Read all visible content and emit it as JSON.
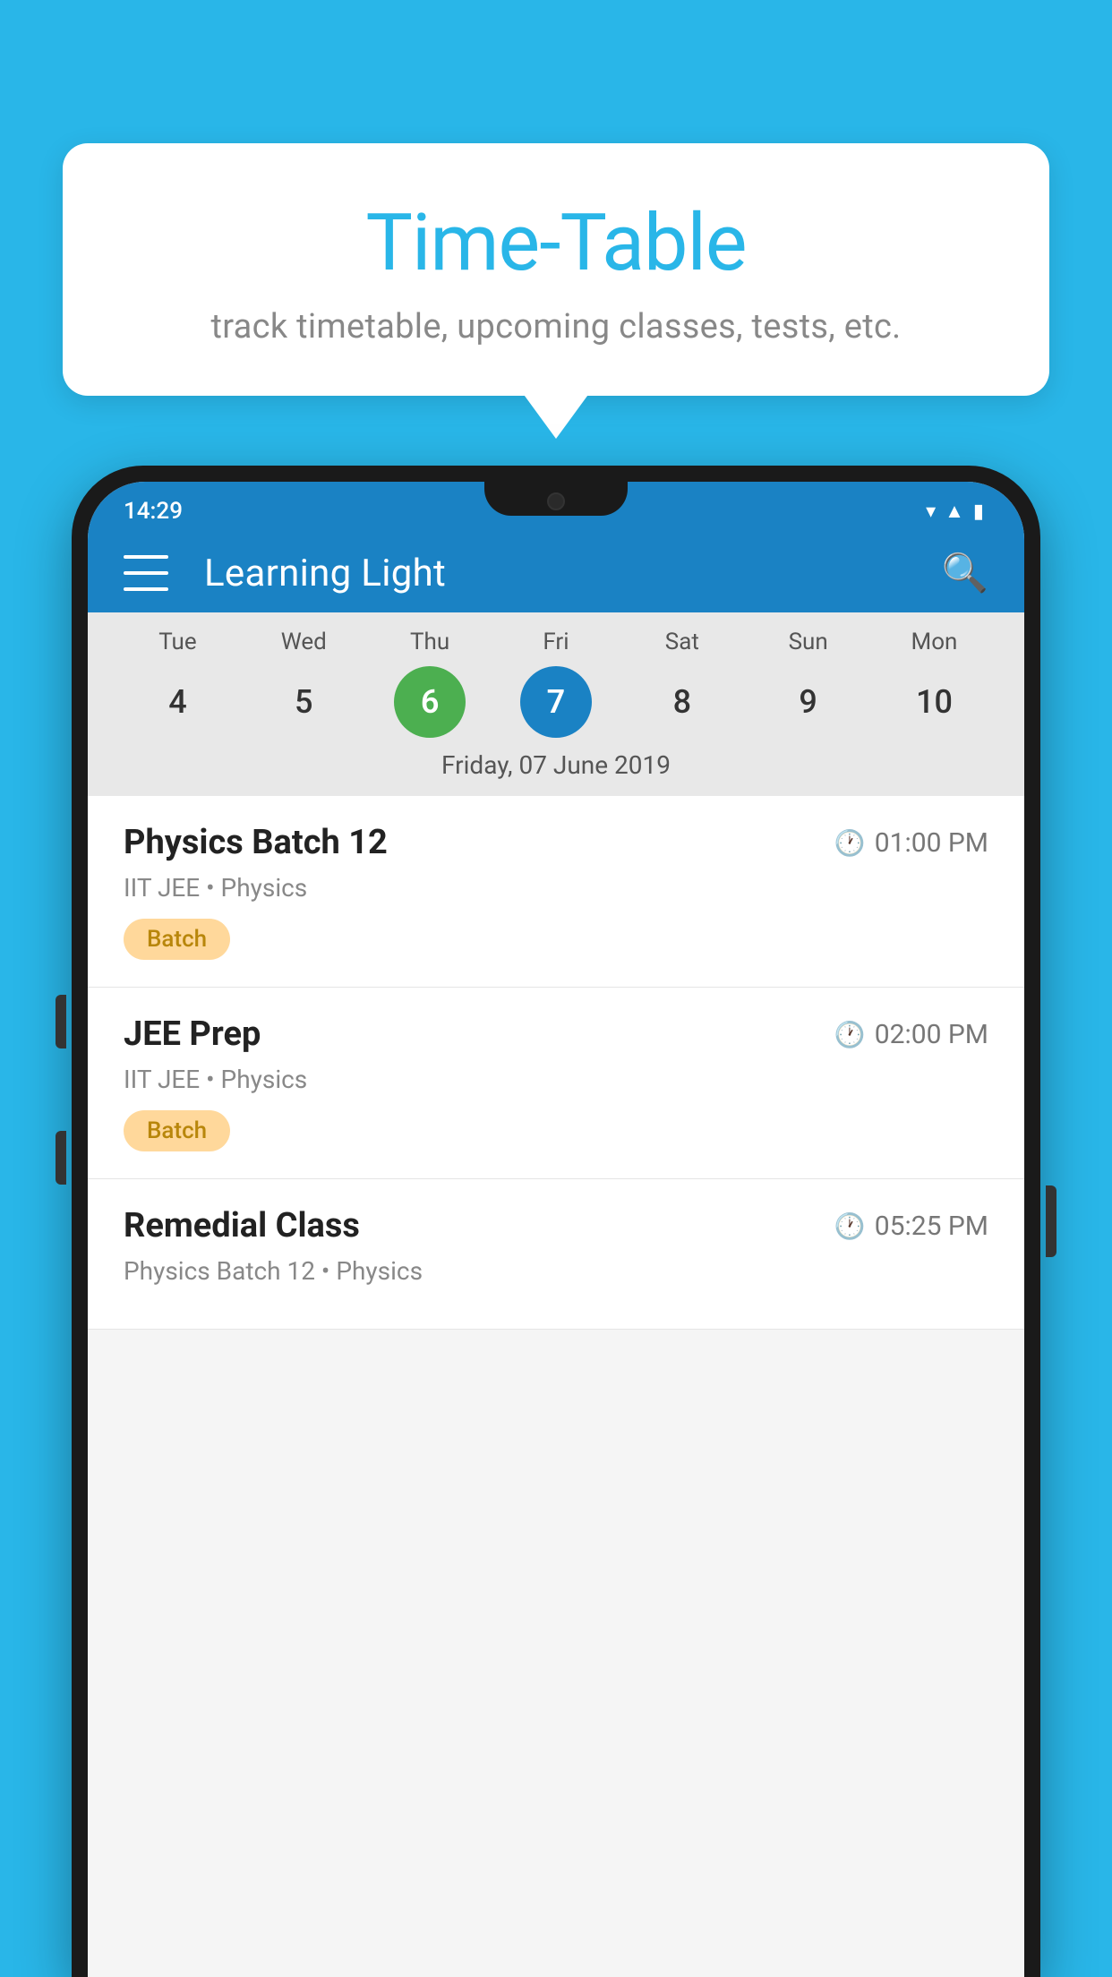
{
  "background_color": "#29b6e8",
  "bubble": {
    "title": "Time-Table",
    "subtitle": "track timetable, upcoming classes, tests, etc."
  },
  "phone": {
    "status_bar": {
      "time": "14:29"
    },
    "app_bar": {
      "title": "Learning Light"
    },
    "calendar": {
      "days": [
        {
          "label": "Tue",
          "num": "4",
          "state": "normal"
        },
        {
          "label": "Wed",
          "num": "5",
          "state": "normal"
        },
        {
          "label": "Thu",
          "num": "6",
          "state": "today"
        },
        {
          "label": "Fri",
          "num": "7",
          "state": "selected"
        },
        {
          "label": "Sat",
          "num": "8",
          "state": "normal"
        },
        {
          "label": "Sun",
          "num": "9",
          "state": "normal"
        },
        {
          "label": "Mon",
          "num": "10",
          "state": "normal"
        }
      ],
      "selected_date_label": "Friday, 07 June 2019"
    },
    "schedule": [
      {
        "title": "Physics Batch 12",
        "time": "01:00 PM",
        "subtitle": "IIT JEE • Physics",
        "tag": "Batch"
      },
      {
        "title": "JEE Prep",
        "time": "02:00 PM",
        "subtitle": "IIT JEE • Physics",
        "tag": "Batch"
      },
      {
        "title": "Remedial Class",
        "time": "05:25 PM",
        "subtitle": "Physics Batch 12 • Physics",
        "tag": null
      }
    ]
  }
}
